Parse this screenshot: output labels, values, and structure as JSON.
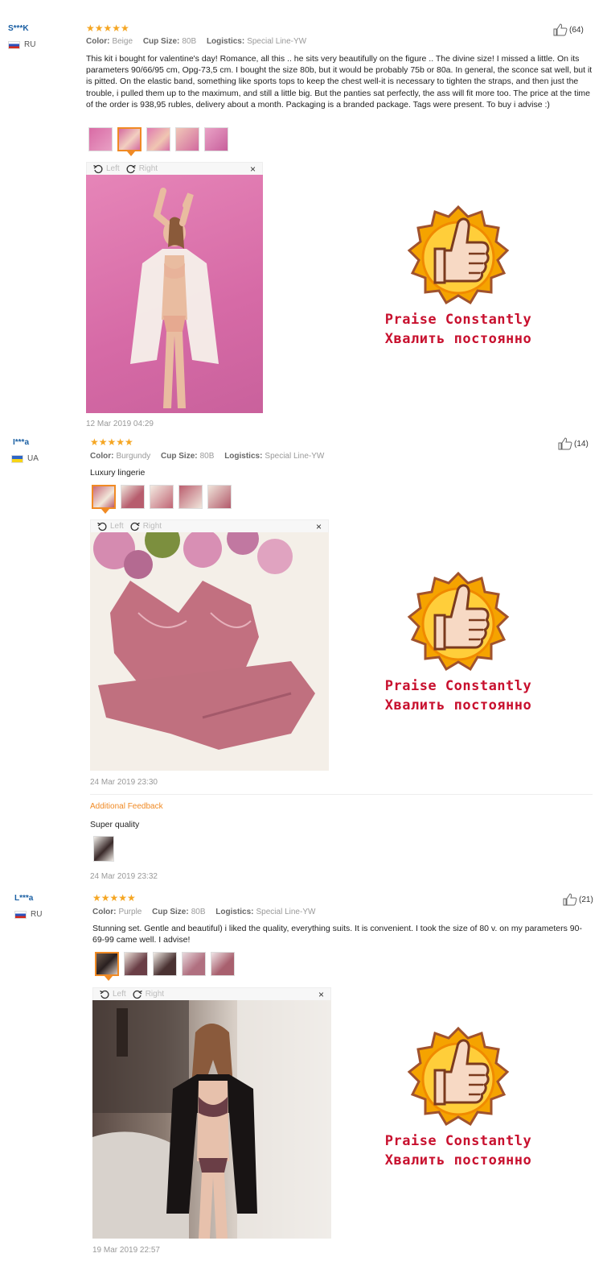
{
  "reviews": [
    {
      "user": "S***K",
      "country": "RU",
      "stars": "★★★★★",
      "color_label": "Color:",
      "color_value": "Beige",
      "cup_label": "Cup Size:",
      "cup_value": "80B",
      "logistics_label": "Logistics:",
      "logistics_value": "Special Line-YW",
      "likes": "(64)",
      "text": "This kit i bought for valentine's day! Romance, all this .. he sits very beautifully on the figure .. The divine size! I missed a little. On its parameters 90/66/95 cm, Opg-73,5 cm. I bought the size 80b, but it would be probably 75b or 80a. In general, the sconce sat well, but it is pitted. On the elastic band, something like sports tops to keep the chest well-it is necessary to tighten the straps, and then just the trouble, i pulled them up to the maximum, and still a little big. But the panties sat perfectly, the ass will fit more too. The price at the time of the order is 938,95 rubles, delivery about a month. Packaging is a branded package. Tags were present. To buy i advise :)",
      "viewer_left": "Left",
      "viewer_right": "Right",
      "viewer_close": "×",
      "date": "12 Mar 2019 04:29"
    },
    {
      "user": "I***a",
      "country": "UA",
      "stars": "★★★★★",
      "color_label": "Color:",
      "color_value": "Burgundy",
      "cup_label": "Cup Size:",
      "cup_value": "80B",
      "logistics_label": "Logistics:",
      "logistics_value": "Special Line-YW",
      "likes": "(14)",
      "text": "Luxury lingerie",
      "viewer_left": "Left",
      "viewer_right": "Right",
      "viewer_close": "×",
      "date": "24 Mar 2019 23:30",
      "additional_label": "Additional Feedback",
      "additional_text": "Super quality",
      "additional_date": "24 Mar 2019 23:32"
    },
    {
      "user": "L***a",
      "country": "RU",
      "stars": "★★★★★",
      "color_label": "Color:",
      "color_value": "Purple",
      "cup_label": "Cup Size:",
      "cup_value": "80B",
      "logistics_label": "Logistics:",
      "logistics_value": "Special Line-YW",
      "likes": "(21)",
      "text": "Stunning set. Gentle and beautiful) i liked the quality, everything suits. It is convenient. I took the size of 80 v. on my parameters 90-69-99 came well. I advise!",
      "viewer_left": "Left",
      "viewer_right": "Right",
      "viewer_close": "×",
      "date": "19 Mar 2019 22:57"
    }
  ],
  "praise": {
    "en": "Praise Constantly",
    "ru": "Хвалить постоянно"
  },
  "colors": {
    "accent": "#f08a24",
    "star": "#f5a623",
    "praise_red": "#c8102e",
    "link_blue": "#1a5fa3"
  }
}
